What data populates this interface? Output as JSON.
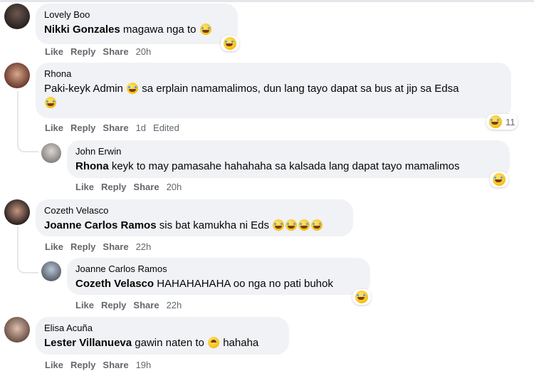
{
  "actions": {
    "like": "Like",
    "reply": "Reply",
    "share": "Share",
    "edited": "Edited"
  },
  "comments": [
    {
      "author": "Lovely Boo",
      "mention": "Nikki Gonzales",
      "text": " magawa nga to",
      "time": "20h",
      "reaction_count": ""
    },
    {
      "author": "Rhona",
      "text_a": "Paki-keyk Admin",
      "text_b": " sa erplain namamalimos, dun lang tayo dapat sa bus at jip sa Edsa",
      "time": "1d",
      "edited": "Edited",
      "reaction_count": "11"
    },
    {
      "author": "John Erwin",
      "mention": "Rhona",
      "text": " keyk to may pamasahe hahahaha sa kalsada lang dapat tayo mamalimos",
      "time": "20h"
    },
    {
      "author": "Cozeth Velasco",
      "mention": "Joanne Carlos Ramos",
      "text": " sis bat kamukha ni Eds",
      "time": "22h"
    },
    {
      "author": "Joanne Carlos Ramos",
      "mention": "Cozeth Velasco",
      "text": " HAHAHAHAHA oo nga no pati buhok",
      "time": "22h"
    },
    {
      "author": "Elisa Acuña",
      "mention": "Lester Villanueva",
      "text": " gawin naten to",
      "text_after": " hahaha",
      "time": "19h"
    }
  ],
  "icons": {
    "laugh": "laughing-crying-emoji",
    "upside": "upside-down-face-emoji",
    "haha": "haha-reaction-icon"
  },
  "colors": {
    "bubble": "#f0f2f5",
    "meta": "#65676b"
  }
}
